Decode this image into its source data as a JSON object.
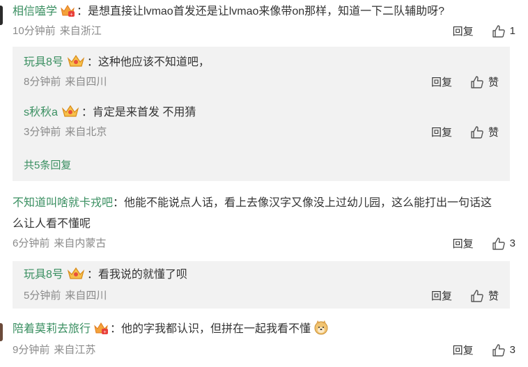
{
  "colors": {
    "username": "#3a8f61",
    "meta": "#8a8a8a",
    "reply_bg": "#f2f2f2",
    "text": "#333333"
  },
  "actions": {
    "reply_label": "回复",
    "like_label": "赞"
  },
  "comments": [
    {
      "user": "相信嗑学",
      "badge_icon": "vip-crown-badge-icon",
      "text": "：是想直接让lvmao首发还是让lvmao来像带on那样，知道一下二队辅助呀?",
      "time": "10分钟前",
      "location": "来自浙江",
      "likes": "1",
      "replies": [
        {
          "user": "玩具8号",
          "badge_icon": "crown-badge-icon",
          "text": "：这种他应该不知道吧，",
          "time": "8分钟前",
          "location": "来自四川"
        },
        {
          "user": "s秋秋a",
          "badge_icon": "crown-badge-icon",
          "text": "：肯定是来首发 不用猜",
          "time": "3分钟前",
          "location": "来自北京"
        }
      ],
      "more_replies": "共5条回复"
    },
    {
      "user": "不知道叫啥就卡戎吧",
      "text_line1": "：他能不能说点人话，看上去像汉字又像没上过幼儿园，这么能打出一句话这",
      "text_line2": "么让人看不懂呢",
      "time": "6分钟前",
      "location": "来自内蒙古",
      "likes": "3",
      "replies": [
        {
          "user": "玩具8号",
          "badge_icon": "crown-badge-icon",
          "text": "：看我说的就懂了呗",
          "time": "5分钟前",
          "location": "来自四川"
        }
      ]
    },
    {
      "user": "陪着莫莉去旅行",
      "badge_icon": "vip-crown-badge-icon",
      "text": "：他的字我都认识，但拼在一起我看不懂",
      "emoji_icon": "doge-emoji-icon",
      "time": "9分钟前",
      "location": "来自江苏",
      "likes": "3"
    }
  ]
}
